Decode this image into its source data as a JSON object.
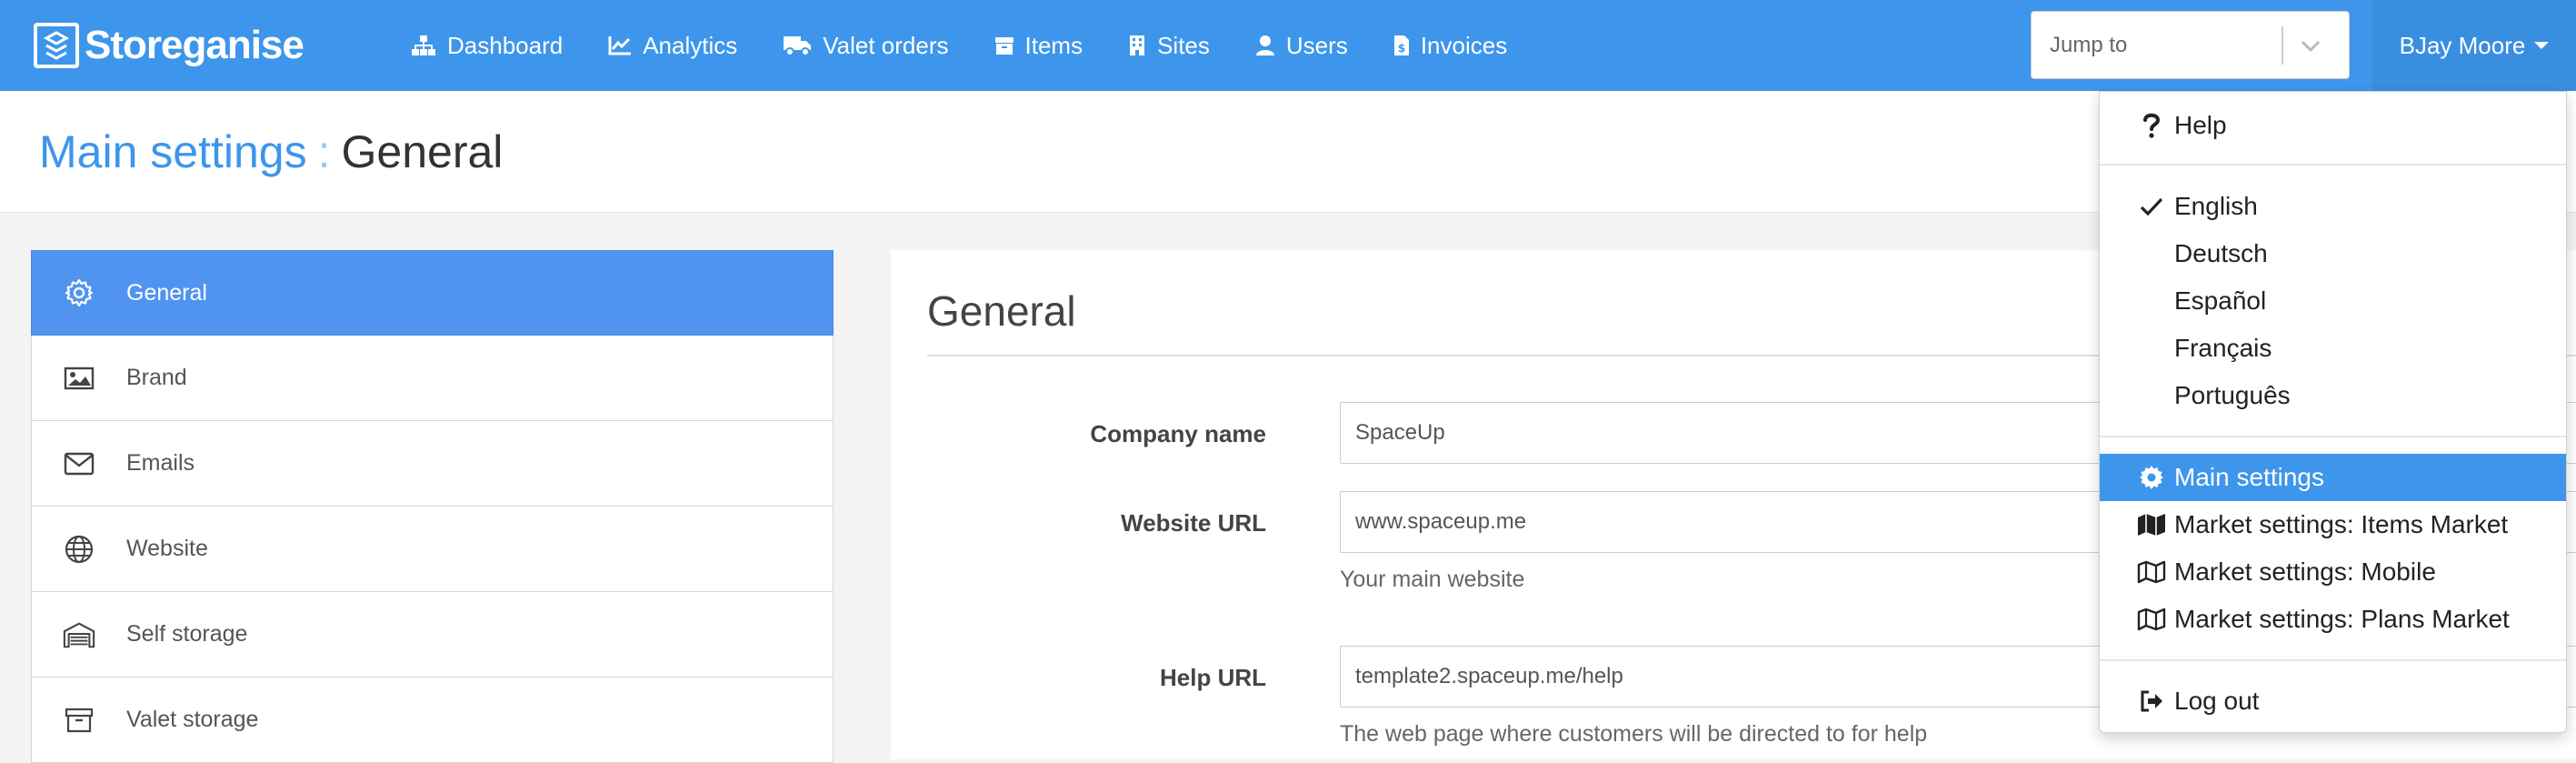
{
  "brand": {
    "name": "Storeganise"
  },
  "nav": {
    "links": [
      {
        "label": "Dashboard",
        "icon": "sitemap-icon"
      },
      {
        "label": "Analytics",
        "icon": "chart-line-icon"
      },
      {
        "label": "Valet orders",
        "icon": "truck-icon"
      },
      {
        "label": "Items",
        "icon": "archive-icon"
      },
      {
        "label": "Sites",
        "icon": "building-icon"
      },
      {
        "label": "Users",
        "icon": "user-icon"
      },
      {
        "label": "Invoices",
        "icon": "file-invoice-icon"
      }
    ],
    "jump_to": {
      "placeholder": "Jump to",
      "value": ""
    },
    "user": {
      "name": "BJay Moore"
    }
  },
  "page_header": {
    "crumb": "Main settings",
    "separator": ":",
    "current": "General"
  },
  "sidebar": {
    "items": [
      {
        "label": "General",
        "icon": "gear-icon",
        "active": true
      },
      {
        "label": "Brand",
        "icon": "image-icon",
        "active": false
      },
      {
        "label": "Emails",
        "icon": "envelope-icon",
        "active": false
      },
      {
        "label": "Website",
        "icon": "globe-icon",
        "active": false
      },
      {
        "label": "Self storage",
        "icon": "warehouse-icon",
        "active": false
      },
      {
        "label": "Valet storage",
        "icon": "archive-icon",
        "active": false
      }
    ]
  },
  "panel": {
    "title": "General",
    "fields": [
      {
        "label": "Company name",
        "value": "SpaceUp",
        "help": ""
      },
      {
        "label": "Website URL",
        "value": "www.spaceup.me",
        "help": "Your main website"
      },
      {
        "label": "Help URL",
        "value": "template2.spaceup.me/help",
        "help": "The web page where customers will be directed to for help"
      }
    ]
  },
  "dropdown": {
    "help": {
      "label": "Help",
      "icon": "question-icon"
    },
    "languages": [
      {
        "label": "English",
        "selected": true
      },
      {
        "label": "Deutsch",
        "selected": false
      },
      {
        "label": "Español",
        "selected": false
      },
      {
        "label": "Français",
        "selected": false
      },
      {
        "label": "Português",
        "selected": false
      }
    ],
    "settings": [
      {
        "label": "Main settings",
        "icon": "gear-icon",
        "active": true
      },
      {
        "label": "Market settings: Items Market",
        "icon": "map-icon",
        "active": false
      },
      {
        "label": "Market settings: Mobile",
        "icon": "map-outline-icon",
        "active": false
      },
      {
        "label": "Market settings: Plans Market",
        "icon": "map-outline-icon",
        "active": false
      }
    ],
    "logout": {
      "label": "Log out",
      "icon": "sign-out-icon"
    }
  },
  "colors": {
    "navbar": "#3d96eb",
    "accent": "#3d96eb",
    "sidebar_active": "#5194f0"
  }
}
